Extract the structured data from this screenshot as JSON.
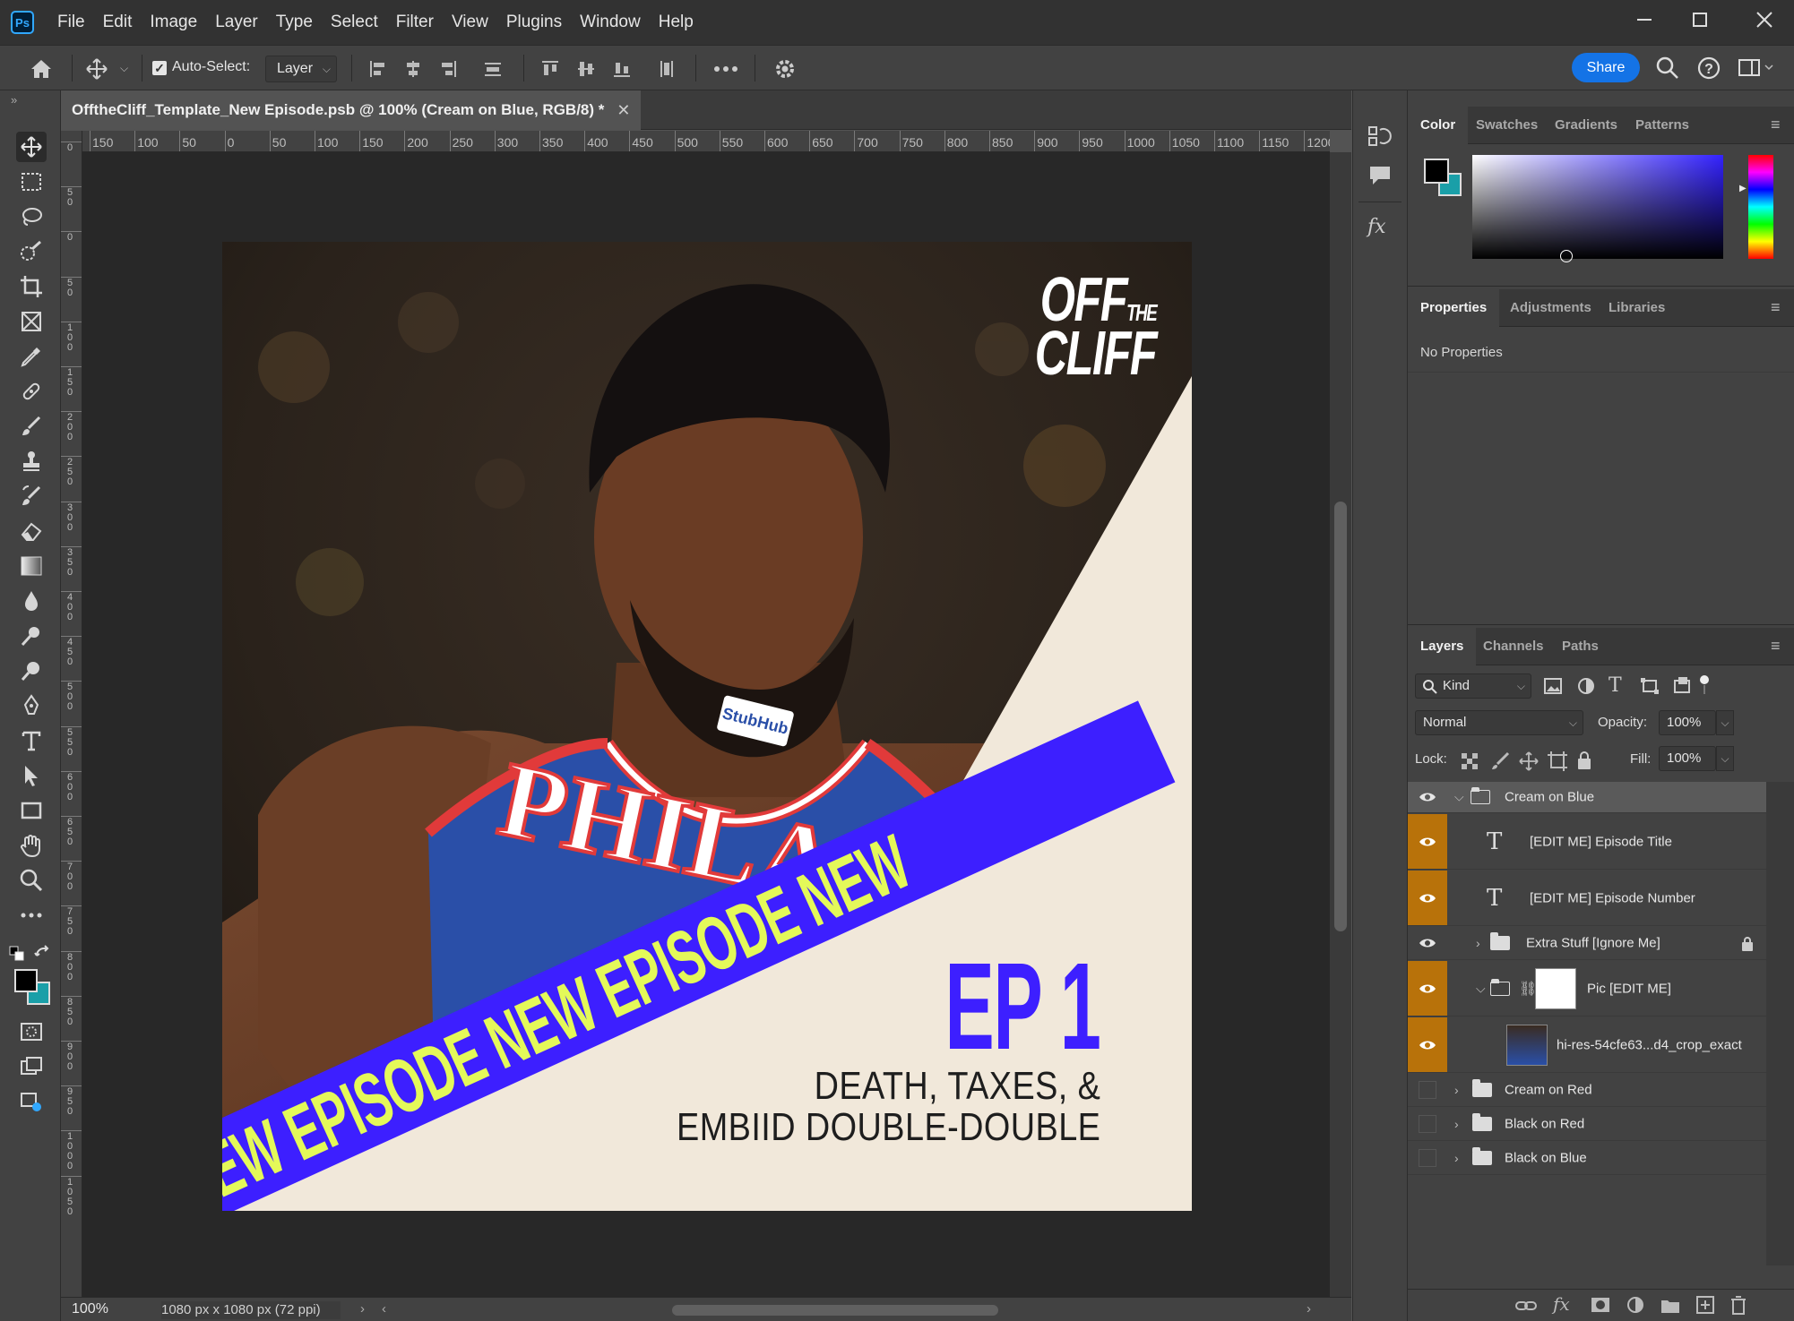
{
  "app": {
    "logo": "Ps"
  },
  "menu": [
    "File",
    "Edit",
    "Image",
    "Layer",
    "Type",
    "Select",
    "Filter",
    "View",
    "Plugins",
    "Window",
    "Help"
  ],
  "options": {
    "auto_select_label": "Auto-Select:",
    "auto_select_checked": true,
    "auto_select_target": "Layer",
    "share_label": "Share"
  },
  "document": {
    "tab_title": "OfftheCliff_Template_New Episode.psb @ 100% (Cream on Blue, RGB/8) *",
    "zoom": "100%",
    "doc_info": "1080 px x 1080 px (72 ppi)",
    "ruler_h": [
      "150",
      "100",
      "50",
      "0",
      "50",
      "100",
      "150",
      "200",
      "250",
      "300",
      "350",
      "400",
      "450",
      "500",
      "550",
      "600",
      "650",
      "700",
      "750",
      "800",
      "850",
      "900",
      "950",
      "1000",
      "1050",
      "1100",
      "1150",
      "1200"
    ],
    "ruler_v": [
      "0",
      "5\n0",
      "0",
      "5\n0",
      "1\n0\n0",
      "1\n5\n0",
      "2\n0\n0",
      "2\n5\n0",
      "3\n0\n0",
      "3\n5\n0",
      "4\n0\n0",
      "4\n5\n0",
      "5\n0\n0",
      "5\n5\n0",
      "6\n0\n0",
      "6\n5\n0",
      "7\n0\n0",
      "7\n5\n0",
      "8\n0\n0",
      "8\n5\n0",
      "9\n0\n0",
      "9\n5\n0",
      "1\n0\n0\n0",
      "1\n0\n5\n0"
    ]
  },
  "artwork": {
    "logo_line1": "OFF",
    "logo_the": "THE",
    "logo_line2": "CLIFF",
    "banner_text": "NEW EPISODE NEW EPISODE NEW",
    "episode_number": "EP 1",
    "title_line1": "DEATH, TAXES, &",
    "title_line2": "EMBIID DOUBLE-DOUBLE",
    "jersey_sponsor": "StubHub",
    "jersey_text": "PHILA",
    "colors": {
      "cream": "#f1e8da",
      "blue": "#3d1fff",
      "lime": "#e4f959",
      "jersey": "#2a4fa8"
    }
  },
  "color_panel": {
    "tabs": [
      "Color",
      "Swatches",
      "Gradients",
      "Patterns"
    ],
    "active": "Color",
    "foreground": "#000000",
    "background": "#1a9fa8"
  },
  "properties_panel": {
    "tabs": [
      "Properties",
      "Adjustments",
      "Libraries"
    ],
    "active": "Properties",
    "empty_text": "No Properties"
  },
  "layers_panel": {
    "tabs": [
      "Layers",
      "Channels",
      "Paths"
    ],
    "active": "Layers",
    "filter_kind": "Kind",
    "blend_mode": "Normal",
    "opacity_label": "Opacity:",
    "opacity": "100%",
    "lock_label": "Lock:",
    "fill_label": "Fill:",
    "fill": "100%",
    "layers": [
      {
        "name": "Cream on Blue",
        "kind": "group-open",
        "visible": true
      },
      {
        "name": "[EDIT ME] Episode Title",
        "kind": "text",
        "visible": true
      },
      {
        "name": "[EDIT ME] Episode Number",
        "kind": "text",
        "visible": true
      },
      {
        "name": "Extra Stuff [Ignore Me]",
        "kind": "group",
        "visible": true,
        "locked": true
      },
      {
        "name": "Pic [EDIT ME]",
        "kind": "group-mask",
        "visible": true
      },
      {
        "name": "hi-res-54cfe63...d4_crop_exact",
        "kind": "image",
        "visible": true
      },
      {
        "name": "Cream on Red",
        "kind": "group",
        "visible": false
      },
      {
        "name": "Black on Red",
        "kind": "group",
        "visible": false
      },
      {
        "name": "Black on Blue",
        "kind": "group",
        "visible": false
      }
    ]
  }
}
